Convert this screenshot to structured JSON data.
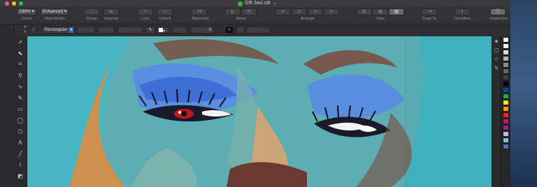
{
  "window": {
    "title": "Gift Jasi.cdr"
  },
  "toolbar": {
    "zoom": {
      "value": "199%",
      "label": "Zoom"
    },
    "view_modes": {
      "value": "Enhanced",
      "label": "View Modes"
    },
    "group": {
      "label": "Group"
    },
    "ungroup": {
      "label": "Ungroup"
    },
    "lock": {
      "label": "Lock"
    },
    "unlock": {
      "label": "Unlock"
    },
    "alignment": {
      "label": "Alignment"
    },
    "mirror": {
      "label": "Mirror"
    },
    "arrange": {
      "label": "Arrange"
    },
    "view": {
      "label": "View"
    },
    "snap_to": {
      "label": "Snap To"
    },
    "get_more": {
      "label": "Get More..."
    },
    "inspectors": {
      "label": "Inspectors"
    }
  },
  "propbar": {
    "x_label": "X:",
    "y_label": "Y:",
    "corner_type": "Rectangular",
    "spin_value": "0",
    "text_value": "0"
  },
  "palette": {
    "colors": [
      "#ffffff",
      "#f2f2f2",
      "#d9d9d9",
      "#b3b3b3",
      "#8c8c8c",
      "#666666",
      "#404040",
      "#000000",
      "#1b3f9c",
      "#1aa64a",
      "#f4e20f",
      "#f39c1b",
      "#e52520",
      "#c0177b",
      "#8a2b8c",
      "#c9b8e6",
      "#7dc1e8",
      "#5e6fa8"
    ]
  }
}
